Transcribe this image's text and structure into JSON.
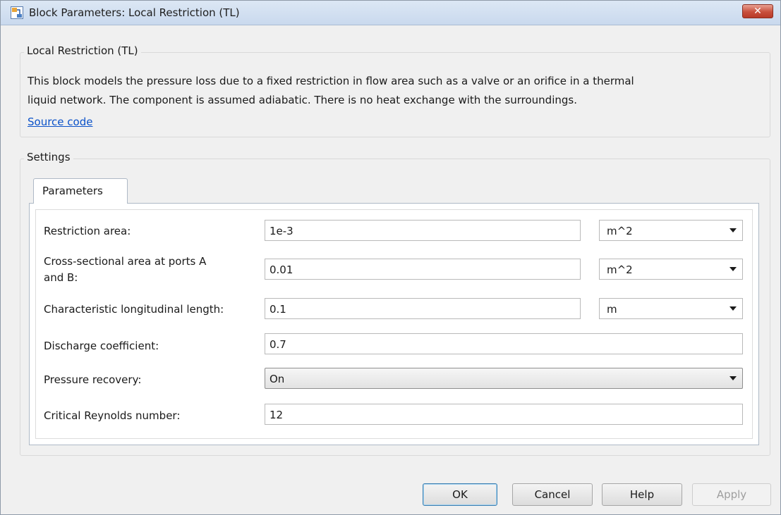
{
  "window": {
    "title": "Block Parameters: Local Restriction (TL)",
    "close_label": "✕"
  },
  "block": {
    "legend": "Local Restriction (TL)",
    "description_line1": "This block models the pressure loss due to a fixed restriction in flow area such as a valve or an orifice in a thermal",
    "description_line2": "liquid network. The component is assumed adiabatic. There is no heat exchange with the surroundings.",
    "source_link": "Source code"
  },
  "settings": {
    "legend": "Settings",
    "tab_label": "Parameters",
    "params": {
      "restriction_area": {
        "label": "Restriction area:",
        "value": "1e-3",
        "unit": "m^2"
      },
      "cross_section": {
        "label_line1": "Cross-sectional area at ports A",
        "label_line2": "and B:",
        "value": "0.01",
        "unit": "m^2"
      },
      "char_length": {
        "label": "Characteristic longitudinal length:",
        "value": "0.1",
        "unit": "m"
      },
      "discharge": {
        "label": "Discharge coefficient:",
        "value": "0.7"
      },
      "pressure_recovery": {
        "label": "Pressure recovery:",
        "value": "On"
      },
      "reynolds": {
        "label": "Critical Reynolds number:",
        "value": "12"
      }
    }
  },
  "buttons": {
    "ok": "OK",
    "cancel": "Cancel",
    "help": "Help",
    "apply": "Apply"
  },
  "colors": {
    "link": "#0b52c9",
    "close_button": "#c84f3c"
  }
}
